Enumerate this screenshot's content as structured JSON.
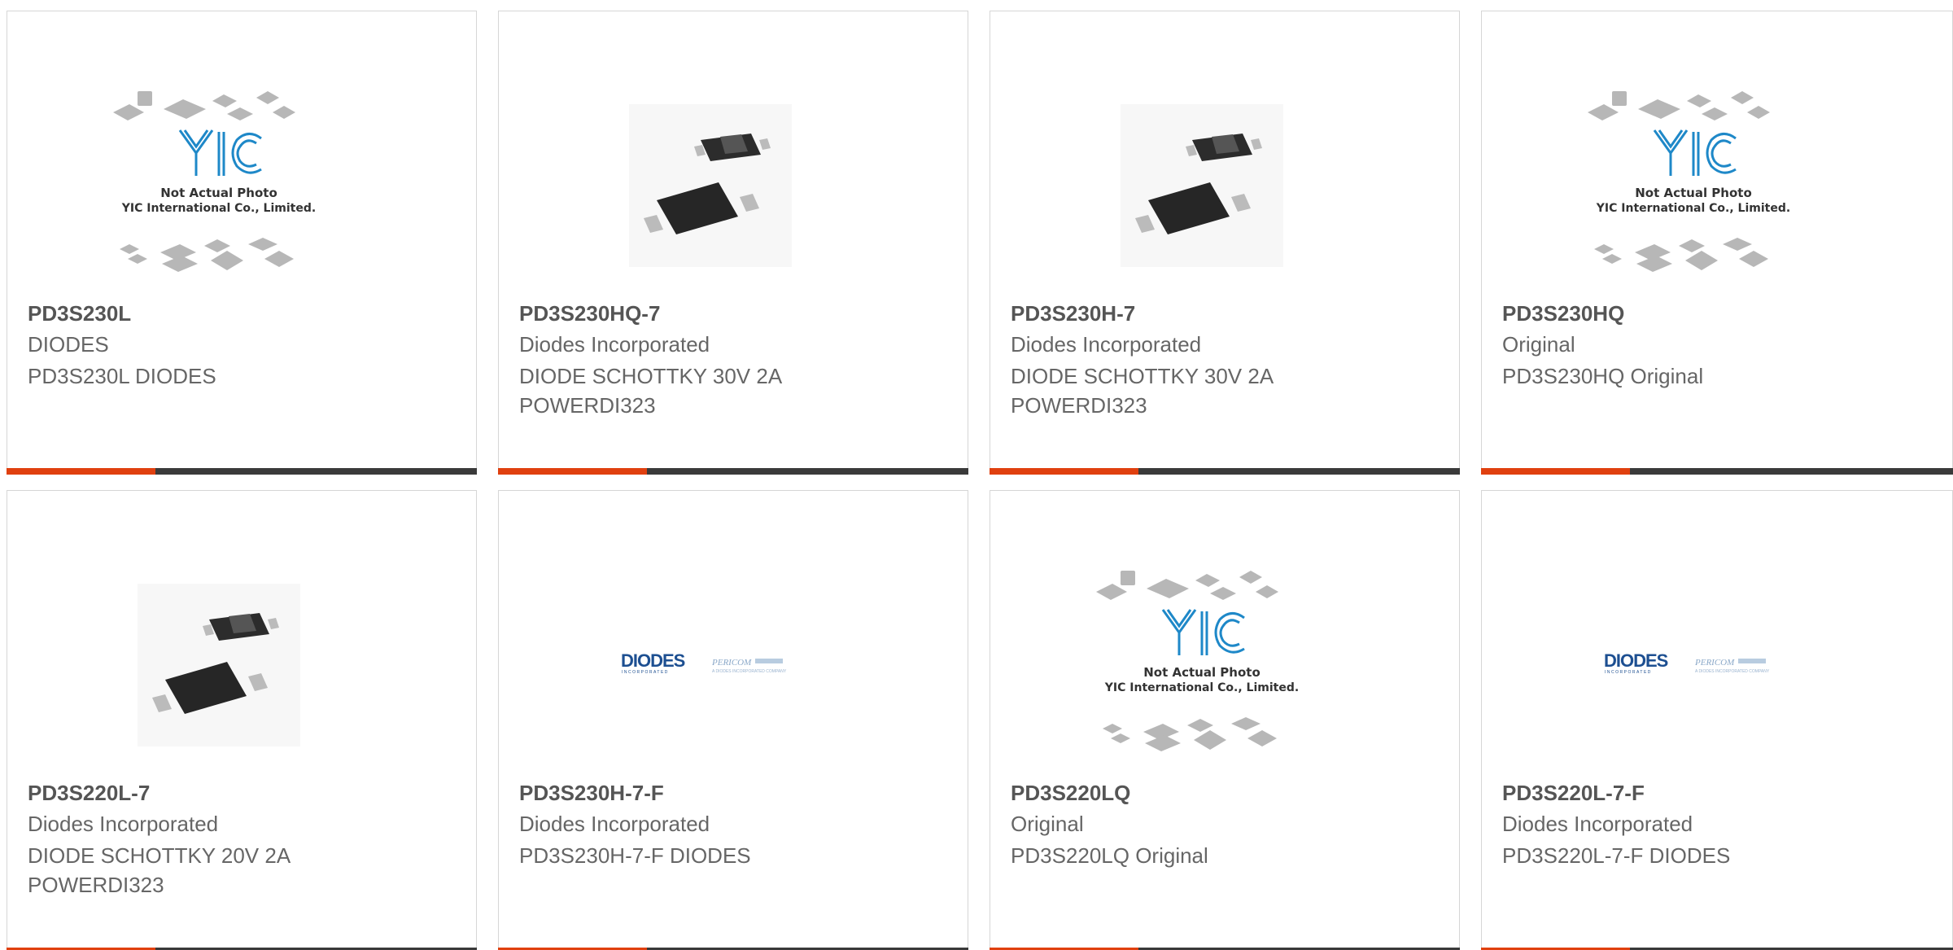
{
  "products": [
    {
      "part": "PD3S230L",
      "manufacturer": "DIODES",
      "description": "PD3S230L DIODES",
      "image": "yic-placeholder-icon"
    },
    {
      "part": "PD3S230HQ-7",
      "manufacturer": "Diodes Incorporated",
      "description": "DIODE SCHOTTKY 30V 2A POWERDI323",
      "image": "diode-package-icon"
    },
    {
      "part": "PD3S230H-7",
      "manufacturer": "Diodes Incorporated",
      "description": "DIODE SCHOTTKY 30V 2A POWERDI323",
      "image": "diode-package-icon"
    },
    {
      "part": "PD3S230HQ",
      "manufacturer": "Original",
      "description": "PD3S230HQ Original",
      "image": "yic-placeholder-icon"
    },
    {
      "part": "PD3S220L-7",
      "manufacturer": "Diodes Incorporated",
      "description": "DIODE SCHOTTKY 20V 2A POWERDI323",
      "image": "diode-package-icon"
    },
    {
      "part": "PD3S230H-7-F",
      "manufacturer": "Diodes Incorporated",
      "description": "PD3S230H-7-F DIODES",
      "image": "diodes-logo-icon"
    },
    {
      "part": "PD3S220LQ",
      "manufacturer": "Original",
      "description": "PD3S220LQ Original",
      "image": "yic-placeholder-icon"
    },
    {
      "part": "PD3S220L-7-F",
      "manufacturer": "Diodes Incorporated",
      "description": "PD3S220L-7-F DIODES",
      "image": "diodes-logo-icon"
    }
  ],
  "placeholder": {
    "brand": "YIC",
    "line1": "Not Actual Photo",
    "line2": "YIC International Co., Limited."
  },
  "logo": {
    "diodes": "DIODES",
    "diodes_sub": "INCORPORATED",
    "pericom": "PERICOM",
    "pericom_sub": "A DIODES INCORPORATED COMPANY"
  },
  "colors": {
    "accent": "#e0400f",
    "bar": "#3a3a3a",
    "yic_blue": "#1e88c8",
    "diodes_blue": "#1d4f91"
  }
}
